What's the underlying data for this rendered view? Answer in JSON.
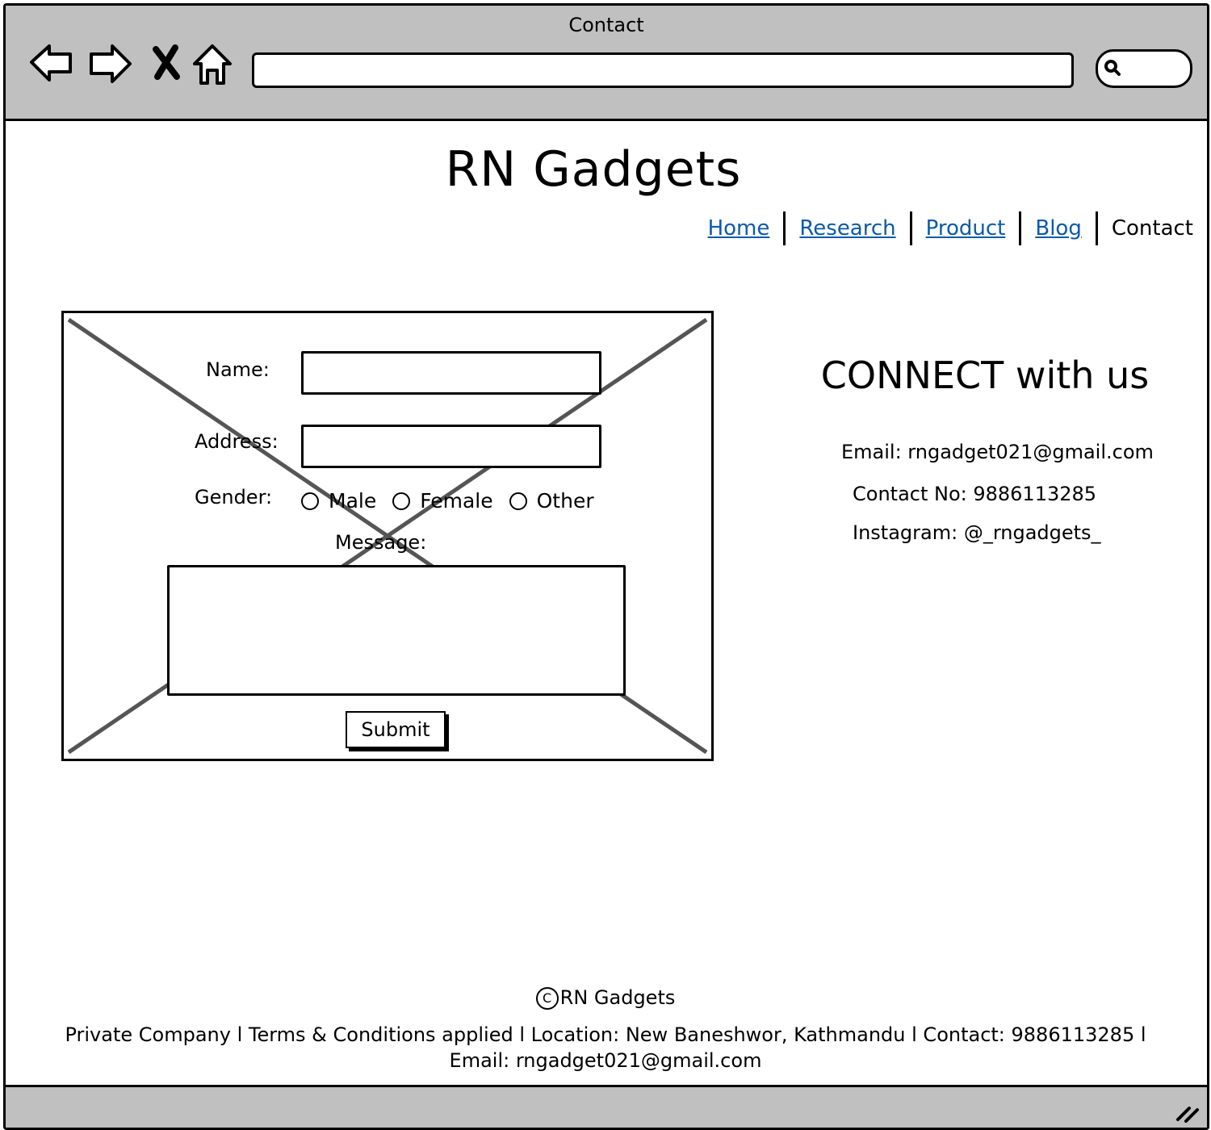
{
  "window": {
    "title": "Contact"
  },
  "site": {
    "title": "RN Gadgets"
  },
  "nav": {
    "items": [
      "Home",
      "Research",
      "Product",
      "Blog"
    ],
    "current": "Contact",
    "link_color": "#0b5aa8"
  },
  "form": {
    "name_label": "Name:",
    "address_label": "Address:",
    "gender_label": "Gender:",
    "gender_options": [
      "Male",
      "Female",
      "Other"
    ],
    "message_label": "Message:",
    "submit_label": "Submit"
  },
  "connect": {
    "heading": "CONNECT with us",
    "email": "Email: rngadget021@gmail.com",
    "contact": "Contact No: 9886113285",
    "instagram": "Instagram: @_rngadgets_"
  },
  "footer": {
    "copyright_symbol": "C",
    "copyright": "RN Gadgets",
    "line1": "Private Company l Terms & Conditions applied l Location: New Baneshwor, Kathmandu l Contact: 9886113285 l",
    "line2": "Email: rngadget021@gmail.com"
  },
  "icons": [
    "back-arrow-icon",
    "forward-arrow-icon",
    "close-icon",
    "home-icon",
    "search-icon",
    "resize-grip-icon"
  ],
  "colors": {
    "chrome": "#c0c0c0",
    "link": "#0b5aa8"
  }
}
